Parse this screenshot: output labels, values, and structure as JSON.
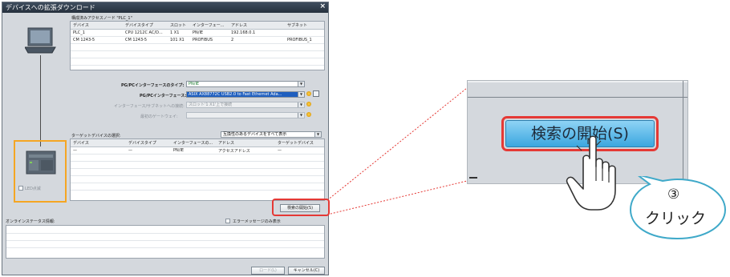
{
  "dialog": {
    "title": "デバイスへの拡張ダウンロード",
    "close": "×",
    "configured_nodes": {
      "title": "構成済みアクセスノード \"PLC_1\"",
      "columns": [
        "デバイス",
        "デバイスタイプ",
        "スロット",
        "インターフェー...",
        "アドレス",
        "サブネット"
      ],
      "rows": [
        [
          "PLC_1",
          "CPU 1212C AC/D...",
          "1 X1",
          "PN/IE",
          "192.168.0.1",
          ""
        ],
        [
          "CM 1243-5",
          "CM 1243-5",
          "101 X1",
          "PROFIBUS",
          "2",
          "PROFIBUS_1"
        ]
      ]
    },
    "pgpc_type_label": "PG/PCインターフェースのタイプ:",
    "pgpc_type_value": "PN/IE",
    "pgpc_if_label": "PG/PCインターフェース:",
    "pgpc_if_value": "ASIX AX88772C USB2.0 to Fast Ethernet Ada...",
    "subnet_conn_label": "インターフェース/サブネットへの接続:",
    "subnet_conn_value": "スロット'1 X1'上で接続",
    "gateway_label": "最初のゲートウェイ:",
    "gateway_value": "",
    "target_label": "ターゲットデバイスの選択:",
    "target_filter": "互換性のあるデバイスをすべて表示",
    "target_table": {
      "columns": [
        "デバイス",
        "デバイスタイプ",
        "インターフェースの...",
        "アドレス",
        "ターゲットデバイス"
      ],
      "rows": [
        [
          "—",
          "—",
          "PN/IE",
          "アクセスアドレス",
          "—"
        ]
      ]
    },
    "led_label": "LED点滅",
    "search_button": "検索の開始(S)",
    "online_status_label": "オンラインステータス情報:",
    "errors_only_label": "エラーメッセージのみ表示",
    "load_button": "ロード(L)",
    "cancel_button": "キャンセル(C)"
  },
  "zoom": {
    "search_button": "検索の開始(S)"
  },
  "callout": {
    "number": "③",
    "text": "クリック"
  },
  "colors": {
    "highlight_red": "#e53935",
    "highlight_orange": "#f5a623",
    "callout_stroke": "#3fa9c9",
    "selected_blue": "#1f5fbf"
  }
}
